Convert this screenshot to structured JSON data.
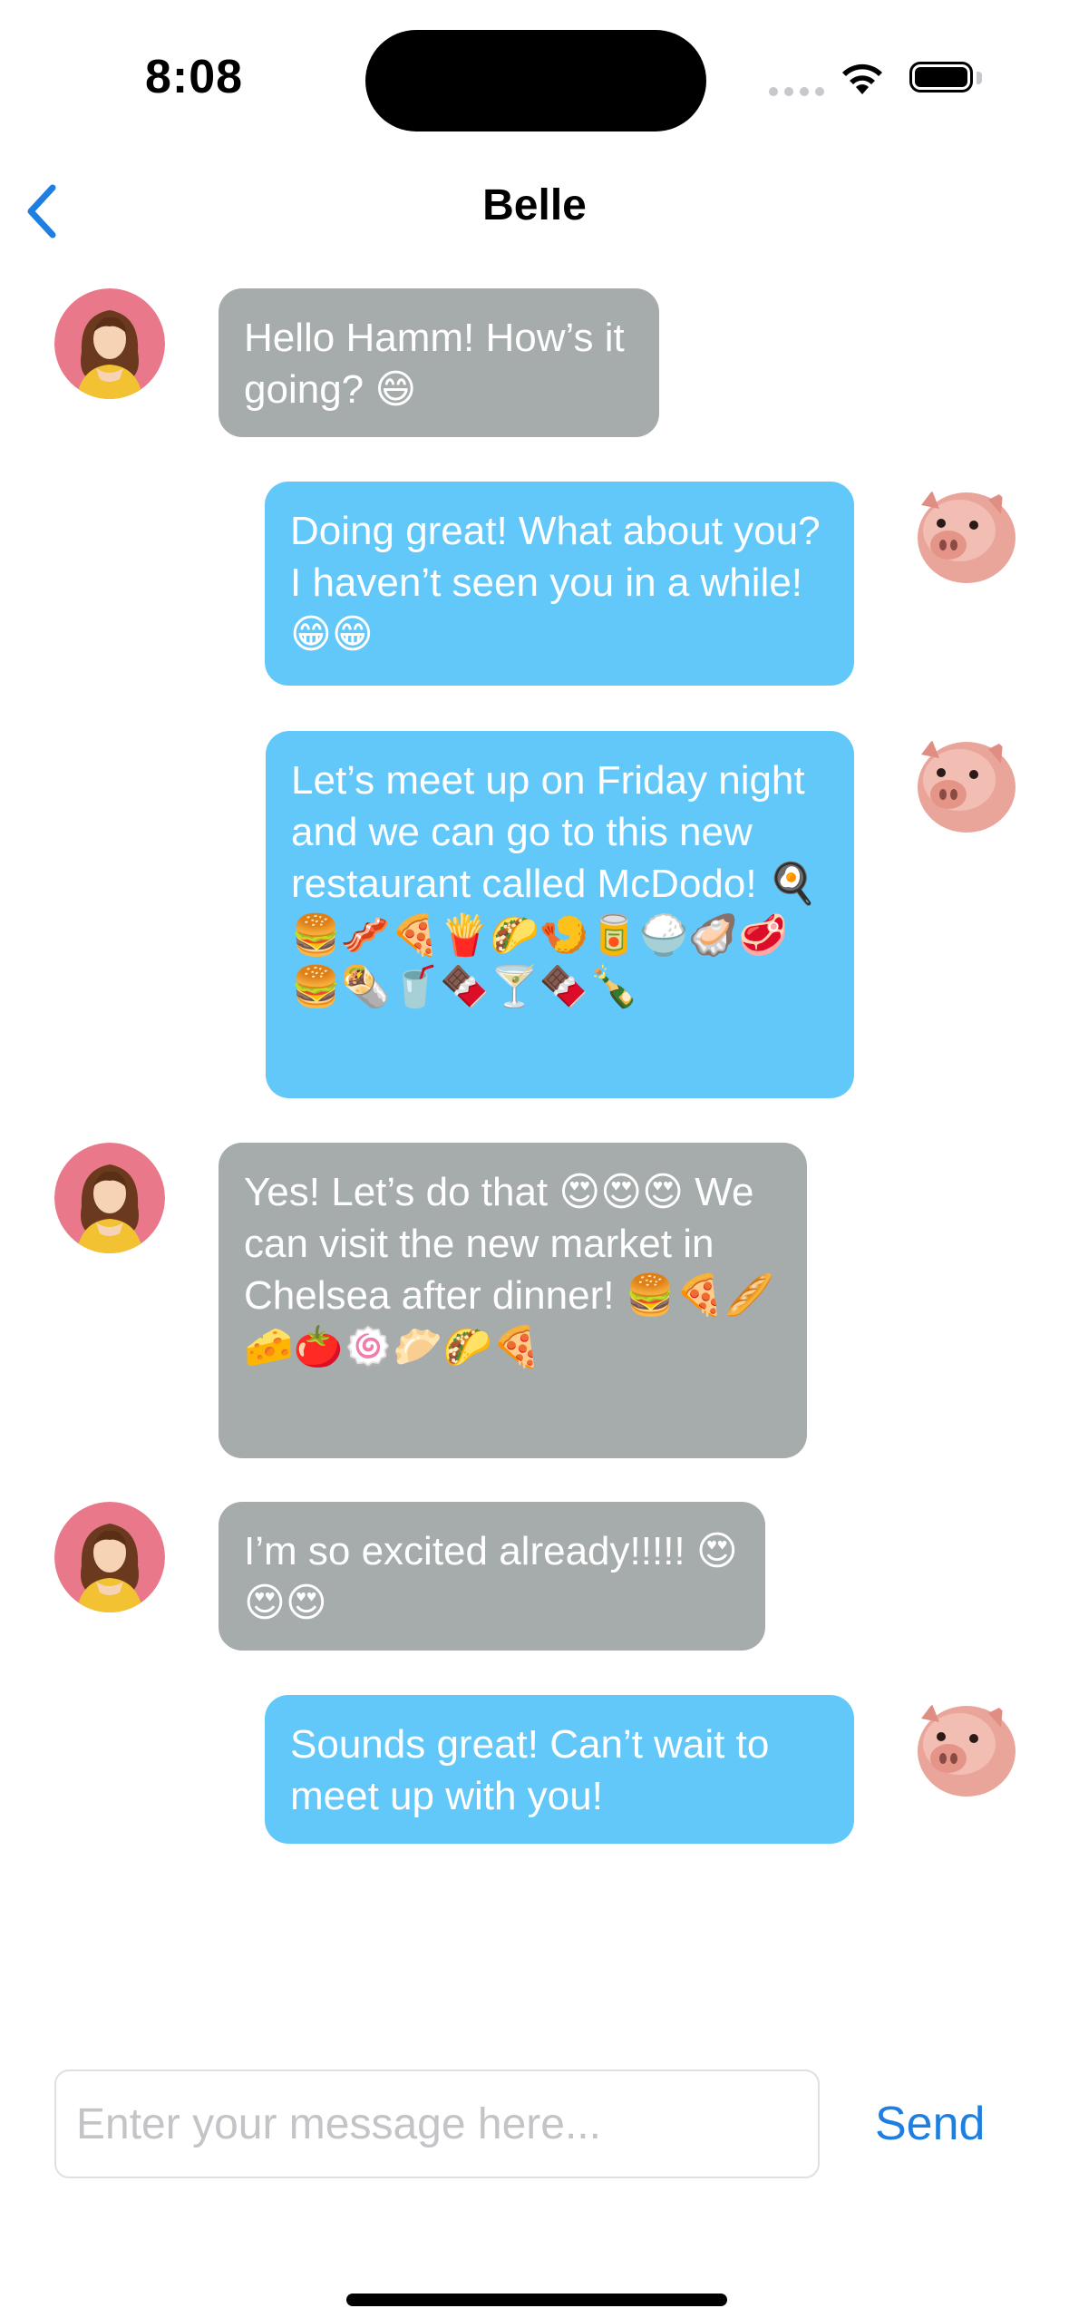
{
  "status_bar": {
    "time": "8:08"
  },
  "nav": {
    "title": "Belle"
  },
  "messages": [
    {
      "sender": "Belle",
      "direction": "incoming",
      "text": "Hello Hamm! How’s it going? 😄"
    },
    {
      "sender": "Hamm",
      "direction": "outgoing",
      "text": "Doing great! What about you? I haven’t seen you in a while! 😁😁"
    },
    {
      "sender": "Hamm",
      "direction": "outgoing",
      "text": "Let’s meet up on Friday night and we can go to this new restaurant called McDodo! 🍳🍔🥓🍕🍟🌮🍤🥫🍚🦪🥩🍔🌯🥤🍫🍸🍫🍾"
    },
    {
      "sender": "Belle",
      "direction": "incoming",
      "text": "Yes! Let’s do that 😍😍😍 We can visit the new market in Chelsea after dinner! 🍔🍕🥖🧀🍅🍥🥟🌮🍕"
    },
    {
      "sender": "Belle",
      "direction": "incoming",
      "text": "I’m so excited already!!!!! 😍😍😍"
    },
    {
      "sender": "Hamm",
      "direction": "outgoing",
      "text": "Sounds great! Can’t wait to meet up with you!"
    }
  ],
  "composer": {
    "placeholder": "Enter your message here...",
    "send_label": "Send"
  },
  "colors": {
    "incoming_bubble": "#a6abab",
    "outgoing_bubble": "#62c8fa",
    "accent": "#1f7fe0"
  }
}
